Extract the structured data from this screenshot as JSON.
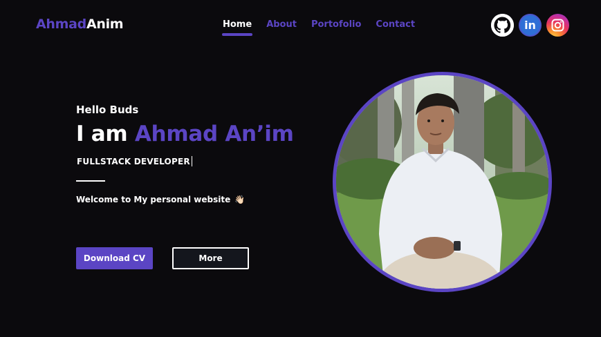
{
  "header": {
    "logo_first": "Ahmad",
    "logo_second": "Anim",
    "nav": [
      "Home",
      "About",
      "Portofolio",
      "Contact"
    ],
    "active_nav": "Home",
    "socials": [
      "github-icon",
      "linkedin-icon",
      "instagram-icon"
    ],
    "linkedin_text": "in"
  },
  "hero": {
    "greeting": "Hello Buds",
    "headline_prefix": "I am",
    "headline_name": "Ahmad An’im",
    "role": "FULLSTACK DEVELOPER",
    "welcome": "Welcome to My personal website",
    "wave_emoji": "👋🏻",
    "download_label": "Download CV",
    "more_label": "More"
  },
  "colors": {
    "accent": "#5b45c4",
    "background": "#0b0a0d",
    "text": "#ffffff"
  }
}
